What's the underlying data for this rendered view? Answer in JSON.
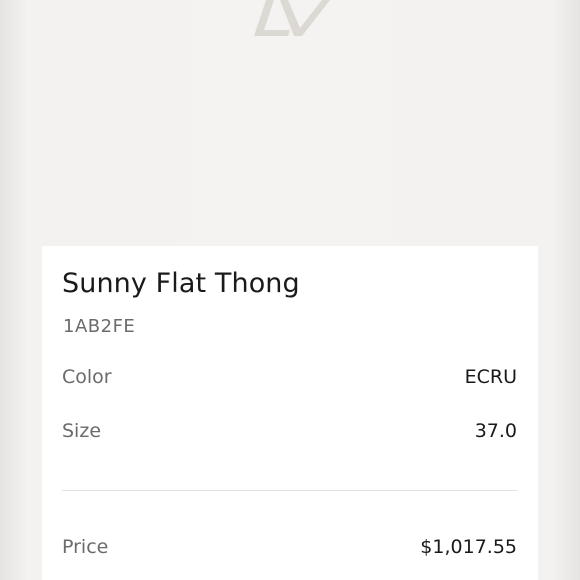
{
  "product": {
    "name": "Sunny Flat Thong",
    "sku": "1AB2FE"
  },
  "details": [
    {
      "label": "Color",
      "value": "ECRU"
    },
    {
      "label": "Size",
      "value": "37.0"
    }
  ],
  "price": {
    "label": "Price",
    "value": "$1,017.55"
  },
  "colors": {
    "background": "#f3f2f0",
    "card": "#ffffff",
    "logo": "#d9d6d1",
    "primary_text": "#1a1a1a",
    "secondary_text": "#6b6b6b"
  },
  "icons": {
    "brand": "lv-monogram-logo"
  }
}
